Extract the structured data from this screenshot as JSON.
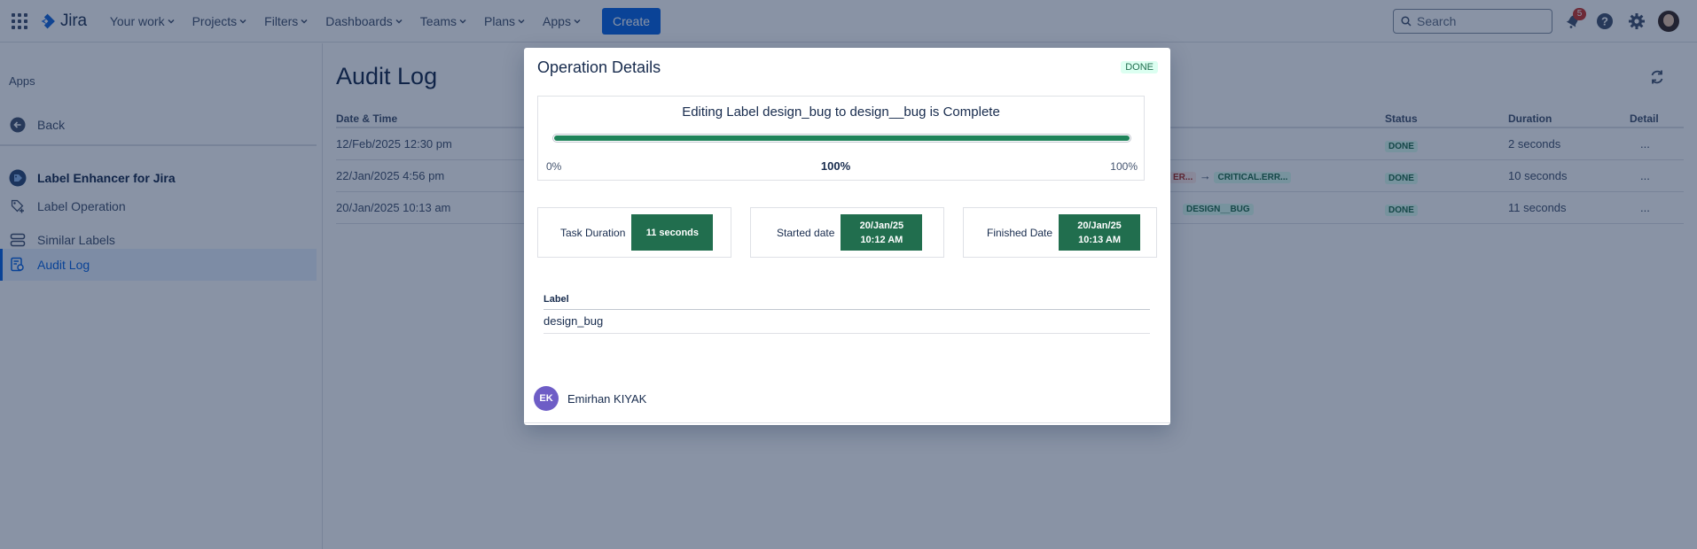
{
  "topnav": {
    "logo": "Jira",
    "items": [
      "Your work",
      "Projects",
      "Filters",
      "Dashboards",
      "Teams",
      "Plans",
      "Apps"
    ],
    "create_label": "Create",
    "search_placeholder": "Search",
    "notification_count": "5"
  },
  "sidebar": {
    "title": "Apps",
    "back_label": "Back",
    "app_name": "Label Enhancer for Jira",
    "items": [
      {
        "label": "Label Operation",
        "icon": "label-operation-icon"
      },
      {
        "label": "Similar Labels",
        "icon": "similar-labels-icon"
      },
      {
        "label": "Audit Log",
        "icon": "audit-log-icon",
        "active": true
      }
    ]
  },
  "main": {
    "title": "Audit Log",
    "columns": {
      "datetime": "Date & Time",
      "status": "Status",
      "duration": "Duration",
      "detail": "Detail"
    },
    "rows": [
      {
        "datetime": "12/Feb/2025 12:30 pm",
        "status": "DONE",
        "duration": "2 seconds",
        "detail": "...",
        "from": "",
        "to": ""
      },
      {
        "datetime": "22/Jan/2025 4:56 pm",
        "status": "DONE",
        "duration": "10 seconds",
        "detail": "...",
        "from": "ER...",
        "arrow": "→",
        "to": "CRITICAL.ERR..."
      },
      {
        "datetime": "20/Jan/2025 10:13 am",
        "status": "DONE",
        "duration": "11 seconds",
        "detail": "...",
        "from": "",
        "to": "DESIGN__BUG"
      }
    ]
  },
  "modal": {
    "title": "Operation Details",
    "status": "DONE",
    "progress": {
      "title": "Editing Label design_bug to design__bug is Complete",
      "min_label": "0%",
      "current_label": "100%",
      "max_label": "100%",
      "fraction": 1.0
    },
    "stats": [
      {
        "label": "Task Duration",
        "value_line1": "11 seconds",
        "value_line2": ""
      },
      {
        "label": "Started date",
        "value_line1": "20/Jan/25",
        "value_line2": "10:12 AM"
      },
      {
        "label": "Finished Date",
        "value_line1": "20/Jan/25",
        "value_line2": "10:13 AM"
      }
    ],
    "label_heading": "Label",
    "label_value": "design_bug",
    "user": {
      "initials": "EK",
      "name": "Emirhan KIYAK"
    }
  },
  "colors": {
    "brand_blue": "#0c66e4",
    "success_green": "#216e4e",
    "progress_green": "#1f845a",
    "overlay": "rgba(9, 30, 66, 0.48)"
  }
}
